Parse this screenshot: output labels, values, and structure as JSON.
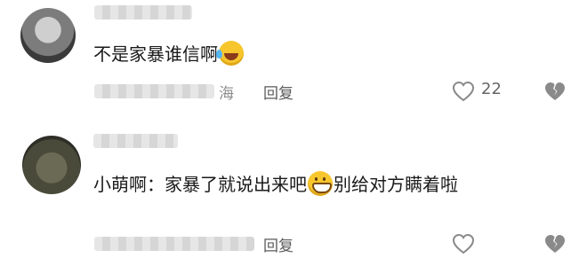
{
  "comments": [
    {
      "text_before": "不是家暴谁信啊",
      "text_after": "",
      "emoji": "laughing-tears-emoji",
      "location": "海",
      "reply_label": "回复",
      "likes": "22"
    },
    {
      "text_before": "小萌啊：家暴了就说出来吧",
      "text_after": "别给对方瞒着啦",
      "emoji": "grinning-emoji",
      "reply_label": "回复"
    }
  ],
  "colors": {
    "text": "#1a1a1a",
    "meta": "#8c8c8c",
    "icon": "#8a8a8a"
  }
}
